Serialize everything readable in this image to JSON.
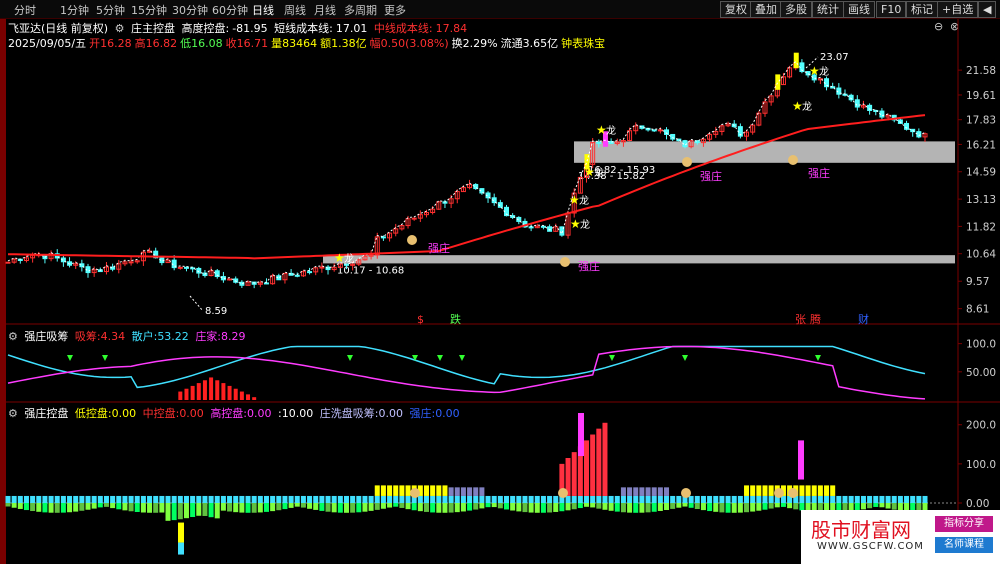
{
  "toolbar": {
    "timeframes": [
      "分时",
      "1分钟",
      "5分钟",
      "15分钟",
      "30分钟",
      "60分钟",
      "日线",
      "周线",
      "月线",
      "多周期",
      "更多"
    ],
    "active": "日线",
    "buttons": [
      "复权",
      "叠加",
      "多股",
      "统计",
      "画线",
      "F10",
      "标记",
      "+自选",
      "◀"
    ]
  },
  "chart_title": {
    "stock": "飞亚达(日线 前复权)",
    "indicator": "庄主控盘",
    "height_label": "高度控盘:",
    "height_value": "-81.95",
    "short_label": "短线成本线:",
    "short_value": "17.01",
    "mid_label": "中线成本线:",
    "mid_value": "17.84"
  },
  "ohlc": {
    "date": "2025/09/05/五",
    "open_label": "开",
    "open": "16.28",
    "high_label": "高",
    "high": "16.82",
    "low_label": "低",
    "low": "16.08",
    "close_label": "收",
    "close": "16.71",
    "vol_label": "量",
    "vol": "83464",
    "amt_label": "额",
    "amt": "1.38亿",
    "chg_label": "幅",
    "chg": "0.50(3.08%)",
    "turn_label": "换",
    "turn": "2.29%",
    "float_label": "流通",
    "float": "3.65亿",
    "sector": "钟表珠宝"
  },
  "price_axis": [
    "21.58",
    "19.61",
    "17.83",
    "16.21",
    "14.59",
    "13.13",
    "11.82",
    "10.64",
    "9.57",
    "8.61"
  ],
  "price_annotations": {
    "high_label": "23.07",
    "low_label": "8.59",
    "zone1": "10.17 - 10.68",
    "zone2": "14.38 - 15.82",
    "zone3": "16.82 - 15.93",
    "dragon": "龙",
    "strong": "强庄",
    "event_marks": [
      "$",
      "跌",
      "张",
      "腾",
      "财"
    ]
  },
  "panel2": {
    "name": "强庄吸筹",
    "s1_label": "吸筹:",
    "s1_value": "4.34",
    "s2_label": "散户:",
    "s2_value": "53.22",
    "s3_label": "庄家:",
    "s3_value": "8.29",
    "axis": [
      "100.0",
      "50.00"
    ]
  },
  "panel3": {
    "name": "强庄控盘",
    "l1_label": "低控盘:",
    "l1_value": "0.00",
    "l2_label": "中控盘:",
    "l2_value": "0.00",
    "l3_label": "高控盘:",
    "l3_value": "0.00",
    "l4_label": ":",
    "l4_value": "10.00",
    "l5_label": "庄洗盘吸筹:",
    "l5_value": "0.00",
    "l6_label": "强庄:",
    "l6_value": "0.00",
    "axis": [
      "200.0",
      "100.0",
      "0.00"
    ]
  },
  "watermark": {
    "title": "股市财富网",
    "url": "WWW.GSCFW.COM",
    "tag1": "指标分享",
    "tag2": "名师课程"
  },
  "colors": {
    "up": "#ff3030",
    "down": "#54ffff",
    "ma_mid": "#ff1e1e",
    "yellow": "#ffff00",
    "magenta": "#ff3cff",
    "cyan": "#40e0ff"
  }
}
